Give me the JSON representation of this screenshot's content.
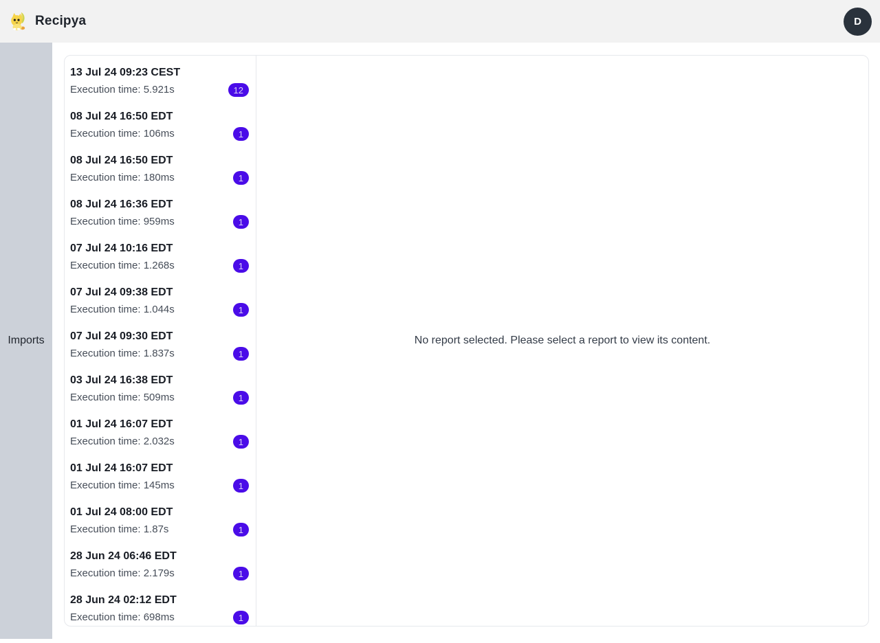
{
  "header": {
    "brand": "Recipya",
    "avatar_initial": "D"
  },
  "sidebar": {
    "tabs": [
      {
        "label": "Imports",
        "selected": true
      }
    ]
  },
  "imports": {
    "reports": [
      {
        "date": "13 Jul 24 09:23 CEST",
        "execution": "Execution time: 5.921s",
        "count": "12"
      },
      {
        "date": "08 Jul 24 16:50 EDT",
        "execution": "Execution time: 106ms",
        "count": "1"
      },
      {
        "date": "08 Jul 24 16:50 EDT",
        "execution": "Execution time: 180ms",
        "count": "1"
      },
      {
        "date": "08 Jul 24 16:36 EDT",
        "execution": "Execution time: 959ms",
        "count": "1"
      },
      {
        "date": "07 Jul 24 10:16 EDT",
        "execution": "Execution time: 1.268s",
        "count": "1"
      },
      {
        "date": "07 Jul 24 09:38 EDT",
        "execution": "Execution time: 1.044s",
        "count": "1"
      },
      {
        "date": "07 Jul 24 09:30 EDT",
        "execution": "Execution time: 1.837s",
        "count": "1"
      },
      {
        "date": "03 Jul 24 16:38 EDT",
        "execution": "Execution time: 509ms",
        "count": "1"
      },
      {
        "date": "01 Jul 24 16:07 EDT",
        "execution": "Execution time: 2.032s",
        "count": "1"
      },
      {
        "date": "01 Jul 24 16:07 EDT",
        "execution": "Execution time: 145ms",
        "count": "1"
      },
      {
        "date": "01 Jul 24 08:00 EDT",
        "execution": "Execution time: 1.87s",
        "count": "1"
      },
      {
        "date": "28 Jun 24 06:46 EDT",
        "execution": "Execution time: 2.179s",
        "count": "1"
      },
      {
        "date": "28 Jun 24 02:12 EDT",
        "execution": "Execution time: 698ms",
        "count": "1"
      }
    ],
    "empty_message": "No report selected. Please select a report to view its content."
  },
  "icons": {
    "logo": "recipya-mascot-cat-banana"
  },
  "colors": {
    "header_bg": "#f2f2f2",
    "sidebar_bg": "#ccd1d9",
    "badge_bg": "#4a0ce8",
    "badge_text": "#d9d2f3",
    "avatar_bg": "#2a323c"
  }
}
